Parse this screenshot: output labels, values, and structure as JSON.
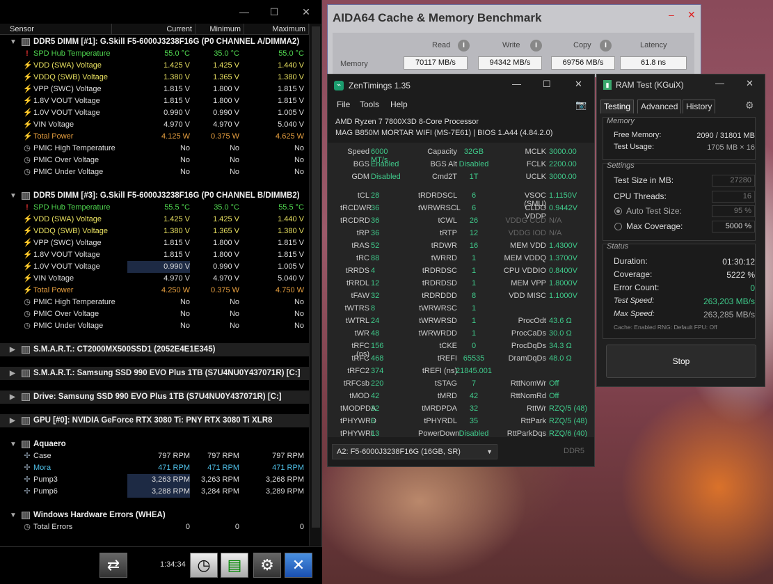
{
  "hwinfo": {
    "columns": {
      "sensor": "Sensor",
      "current": "Current",
      "minimum": "Minimum",
      "maximum": "Maximum"
    },
    "groups": [
      {
        "title": "DDR5 DIMM [#1]: G.Skill F5-6000J3238F16G (P0 CHANNEL A/DIMMA2)"
      },
      {
        "title": "DDR5 DIMM [#3]: G.Skill F5-6000J3238F16G (P0 CHANNEL B/DIMMB2)"
      },
      {
        "title": "S.M.A.R.T.: CT2000MX500SSD1 (2052E4E1E345)"
      },
      {
        "title": "S.M.A.R.T.: Samsung SSD 990 EVO Plus 1TB (S7U4NU0Y437071R) [C:]"
      },
      {
        "title": "Drive: Samsung SSD 990 EVO Plus 1TB (S7U4NU0Y437071R) [C:]"
      },
      {
        "title": "GPU [#0]: NVIDIA GeForce RTX 3080 Ti: PNY RTX 3080 Ti XLR8"
      },
      {
        "title": "Aquaero"
      },
      {
        "title": "Windows Hardware Errors (WHEA)"
      }
    ],
    "dimm1": [
      {
        "name": "SPD Hub Temperature",
        "cur": "55.0 °C",
        "min": "35.0 °C",
        "max": "55.0 °C"
      },
      {
        "name": "VDD (SWA) Voltage",
        "cur": "1.425 V",
        "min": "1.425 V",
        "max": "1.440 V"
      },
      {
        "name": "VDDQ (SWB) Voltage",
        "cur": "1.380 V",
        "min": "1.365 V",
        "max": "1.380 V"
      },
      {
        "name": "VPP (SWC) Voltage",
        "cur": "1.815 V",
        "min": "1.800 V",
        "max": "1.815 V"
      },
      {
        "name": "1.8V VOUT Voltage",
        "cur": "1.815 V",
        "min": "1.800 V",
        "max": "1.815 V"
      },
      {
        "name": "1.0V VOUT Voltage",
        "cur": "0.990 V",
        "min": "0.990 V",
        "max": "1.005 V"
      },
      {
        "name": "VIN Voltage",
        "cur": "4.970 V",
        "min": "4.970 V",
        "max": "5.040 V"
      },
      {
        "name": "Total Power",
        "cur": "4.125 W",
        "min": "0.375 W",
        "max": "4.625 W"
      },
      {
        "name": "PMIC High Temperature",
        "cur": "No",
        "min": "No",
        "max": "No"
      },
      {
        "name": "PMIC Over Voltage",
        "cur": "No",
        "min": "No",
        "max": "No"
      },
      {
        "name": "PMIC Under Voltage",
        "cur": "No",
        "min": "No",
        "max": "No"
      }
    ],
    "dimm3": [
      {
        "name": "SPD Hub Temperature",
        "cur": "55.5 °C",
        "min": "35.0 °C",
        "max": "55.5 °C"
      },
      {
        "name": "VDD (SWA) Voltage",
        "cur": "1.425 V",
        "min": "1.425 V",
        "max": "1.440 V"
      },
      {
        "name": "VDDQ (SWB) Voltage",
        "cur": "1.380 V",
        "min": "1.365 V",
        "max": "1.380 V"
      },
      {
        "name": "VPP (SWC) Voltage",
        "cur": "1.815 V",
        "min": "1.800 V",
        "max": "1.815 V"
      },
      {
        "name": "1.8V VOUT Voltage",
        "cur": "1.815 V",
        "min": "1.800 V",
        "max": "1.815 V"
      },
      {
        "name": "1.0V VOUT Voltage",
        "cur": "0.990 V",
        "min": "0.990 V",
        "max": "1.005 V"
      },
      {
        "name": "VIN Voltage",
        "cur": "4.970 V",
        "min": "4.970 V",
        "max": "5.040 V"
      },
      {
        "name": "Total Power",
        "cur": "4.250 W",
        "min": "0.375 W",
        "max": "4.750 W"
      },
      {
        "name": "PMIC High Temperature",
        "cur": "No",
        "min": "No",
        "max": "No"
      },
      {
        "name": "PMIC Over Voltage",
        "cur": "No",
        "min": "No",
        "max": "No"
      },
      {
        "name": "PMIC Under Voltage",
        "cur": "No",
        "min": "No",
        "max": "No"
      }
    ],
    "aquaero": [
      {
        "name": "Case",
        "cur": "797 RPM",
        "min": "797 RPM",
        "max": "797 RPM"
      },
      {
        "name": "Mora",
        "cur": "471 RPM",
        "min": "471 RPM",
        "max": "471 RPM"
      },
      {
        "name": "Pump3",
        "cur": "3,263 RPM",
        "min": "3,263 RPM",
        "max": "3,268 RPM"
      },
      {
        "name": "Pump6",
        "cur": "3,288 RPM",
        "min": "3,284 RPM",
        "max": "3,289 RPM"
      }
    ],
    "whea": [
      {
        "name": "Total Errors",
        "cur": "0",
        "min": "0",
        "max": "0"
      }
    ],
    "timer": "1:34:34"
  },
  "aida": {
    "title": "AIDA64 Cache & Memory Benchmark",
    "cols": [
      "Read",
      "Write",
      "Copy",
      "Latency"
    ],
    "row_label": "Memory",
    "values": [
      "70117 MB/s",
      "94342 MB/s",
      "69756 MB/s",
      "61.8 ns"
    ]
  },
  "zen": {
    "title": "ZenTimings 1.35",
    "menu": [
      "File",
      "Tools",
      "Help"
    ],
    "cpu": "AMD Ryzen 7 7800X3D 8-Core Processor",
    "board": "MAG B850M MORTAR WIFI (MS-7E61) | BIOS 1.A44 (4.84.2.0)",
    "top": [
      [
        "Speed",
        "6000 MT/s",
        "Capacity",
        "32GB",
        "MCLK",
        "3000.00"
      ],
      [
        "BGS",
        "Enabled",
        "BGS Alt",
        "Disabled",
        "FCLK",
        "2200.00"
      ],
      [
        "GDM",
        "Disabled",
        "Cmd2T",
        "1T",
        "UCLK",
        "3000.00"
      ]
    ],
    "rows": [
      [
        "tCL",
        "28",
        "tRDRDSCL",
        "6",
        "VSOC (SMU)",
        "1.1150V"
      ],
      [
        "tRCDWR",
        "36",
        "tWRWRSCL",
        "6",
        "CLDO VDDP",
        "0.9442V"
      ],
      [
        "tRCDRD",
        "36",
        "tCWL",
        "26",
        "VDDG CCD",
        "N/A"
      ],
      [
        "tRP",
        "36",
        "tRTP",
        "12",
        "VDDG IOD",
        "N/A"
      ],
      [
        "tRAS",
        "52",
        "tRDWR",
        "16",
        "MEM VDD",
        "1.4300V"
      ],
      [
        "tRC",
        "88",
        "tWRRD",
        "1",
        "MEM VDDQ",
        "1.3700V"
      ],
      [
        "tRRDS",
        "4",
        "tRDRDSC",
        "1",
        "CPU VDDIO",
        "0.8400V"
      ],
      [
        "tRRDL",
        "12",
        "tRDRDSD",
        "1",
        "MEM VPP",
        "1.8000V"
      ],
      [
        "tFAW",
        "32",
        "tRDRDDD",
        "8",
        "VDD MISC",
        "1.1000V"
      ],
      [
        "tWTRS",
        "8",
        "tWRWRSC",
        "1",
        "",
        ""
      ],
      [
        "tWTRL",
        "24",
        "tWRWRSD",
        "1",
        "ProcOdt",
        "43.6 Ω"
      ],
      [
        "tWR",
        "48",
        "tWRWRDD",
        "1",
        "ProcCaDs",
        "30.0 Ω"
      ],
      [
        "tRFC (ns)",
        "156",
        "tCKE",
        "0",
        "ProcDqDs",
        "34.3 Ω"
      ],
      [
        "tRFC",
        "468",
        "tREFI",
        "65535",
        "DramDqDs",
        "48.0 Ω"
      ],
      [
        "tRFC2",
        "374",
        "tREFI (ns)",
        "21845.001",
        "",
        ""
      ],
      [
        "tRFCsb",
        "220",
        "tSTAG",
        "7",
        "RttNomWr",
        "Off"
      ],
      [
        "tMOD",
        "42",
        "tMRD",
        "42",
        "RttNomRd",
        "Off"
      ],
      [
        "tMODPDA",
        "32",
        "tMRDPDA",
        "32",
        "RttWr",
        "RZQ/5 (48)"
      ],
      [
        "tPHYWRD",
        "6",
        "tPHYRDL",
        "35",
        "RttPark",
        "RZQ/5 (48)"
      ],
      [
        "tPHYWRL",
        "13",
        "PowerDown",
        "Disabled",
        "RttParkDqs",
        "RZQ/6 (40)"
      ]
    ],
    "module": "A2: F5-6000J3238F16G (16GB, SR)",
    "ddr": "DDR5"
  },
  "ramtest": {
    "title": "RAM Test (KGuiX)",
    "tabs": [
      "Testing",
      "Advanced",
      "History"
    ],
    "memory_title": "Memory",
    "free_memory_label": "Free Memory:",
    "free_memory": "2090 / 31801 MB",
    "test_usage_label": "Test Usage:",
    "test_usage": "1705 MB × 16",
    "settings_title": "Settings",
    "test_size_label": "Test Size in MB:",
    "test_size": "27280",
    "cpu_threads_label": "CPU Threads:",
    "cpu_threads": "16",
    "auto_size_label": "Auto Test Size:",
    "auto_size": "95 %",
    "max_cov_label": "Max Coverage:",
    "max_cov": "5000 %",
    "status_title": "Status",
    "duration_label": "Duration:",
    "duration": "01:30:12",
    "coverage_label": "Coverage:",
    "coverage": "5222 %",
    "errors_label": "Error Count:",
    "errors": "0",
    "speed_label": "Test Speed:",
    "speed": "263,203 MB/s",
    "maxspeed_label": "Max Speed:",
    "maxspeed": "263,285 MB/s",
    "cache_info": "Cache: Enabled  RNG: Default  FPU: Off",
    "stop": "Stop"
  }
}
